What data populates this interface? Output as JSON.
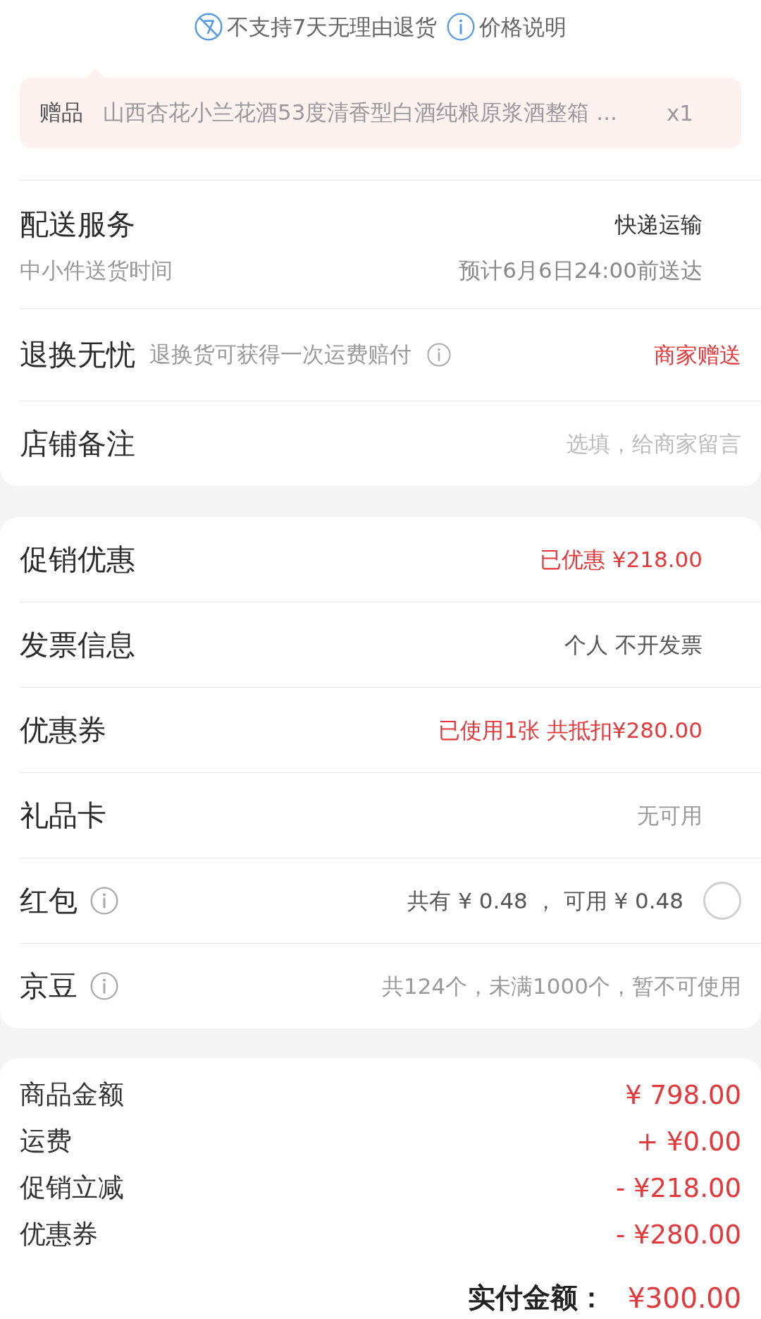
{
  "notices": [
    {
      "kind": "no-return",
      "text": "不支持7天无理由退货"
    },
    {
      "kind": "info",
      "text": "价格说明"
    }
  ],
  "gift": {
    "label": "赠品",
    "name": "山西杏花小兰花酒53度清香型白酒纯粮原浆酒整箱 ...",
    "quantity": "x1"
  },
  "delivery": {
    "title": "配送服务",
    "method": "快递运输",
    "subtitle": "中小件送货时间",
    "estimate": "预计6月6日24:00前送达"
  },
  "return_service": {
    "title": "退换无忧",
    "description": "退换货可获得一次运费赔付",
    "status": "商家赠送"
  },
  "store_note": {
    "title": "店铺备注",
    "placeholder": "选填，给商家留言"
  },
  "options": [
    {
      "kind": "link",
      "title": "促销优惠",
      "value": "已优惠 ¥218.00",
      "color": "#e4393c",
      "info_icon": false
    },
    {
      "kind": "link",
      "title": "发票信息",
      "value": "个人 不开发票",
      "color": "#555555",
      "info_icon": false
    },
    {
      "kind": "link",
      "title": "优惠券",
      "value": "已使用1张 共抵扣¥280.00",
      "color": "#e4393c",
      "info_icon": false
    },
    {
      "kind": "link",
      "title": "礼品卡",
      "value": "无可用",
      "color": "#999999",
      "info_icon": false
    },
    {
      "kind": "toggle",
      "title": "红包",
      "value": "共有 ¥ 0.48 ， 可用 ¥ 0.48",
      "color": "#555555",
      "info_icon": true,
      "checked": false
    },
    {
      "kind": "plain",
      "title": "京豆",
      "value": "共124个，未满1000个，暂不可使用",
      "color": "#999999",
      "info_icon": true
    }
  ],
  "summary": [
    {
      "label": "商品金额",
      "value": "¥ 798.00"
    },
    {
      "label": "运费",
      "value": "+ ¥0.00"
    },
    {
      "label": "促销立减",
      "value": "- ¥218.00"
    },
    {
      "label": "优惠券",
      "value": "- ¥280.00"
    }
  ],
  "total": {
    "label": "实付金额：",
    "value": "¥300.00"
  }
}
